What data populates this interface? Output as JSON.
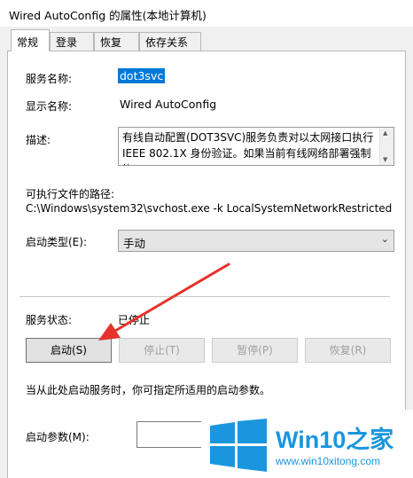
{
  "window": {
    "title": "Wired AutoConfig 的属性(本地计算机)"
  },
  "tabs": [
    {
      "label": "常规",
      "active": true
    },
    {
      "label": "登录",
      "active": false
    },
    {
      "label": "恢复",
      "active": false
    },
    {
      "label": "依存关系",
      "active": false
    }
  ],
  "general": {
    "service_name_label": "服务名称:",
    "service_name_value": "dot3svc",
    "display_name_label": "显示名称:",
    "display_name_value": "Wired AutoConfig",
    "description_label": "描述:",
    "description_value": "有线自动配置(DOT3SVC)服务负责对以太网接口执行 IEEE 802.1X 身份验证。如果当前有线网络部署强制执",
    "exe_path_label": "可执行文件的路径:",
    "exe_path_value": "C:\\Windows\\system32\\svchost.exe -k LocalSystemNetworkRestricted",
    "startup_type_label": "启动类型(E):",
    "startup_type_value": "手动",
    "service_status_label": "服务状态:",
    "service_status_value": "已停止",
    "buttons": {
      "start": "启动(S)",
      "stop": "停止(T)",
      "pause": "暂停(P)",
      "resume": "恢复(R)"
    },
    "hint": "当从此处启动服务时，你可指定所适用的启动参数。",
    "start_params_label": "启动参数(M):"
  },
  "watermark": {
    "brand": "Win10之家",
    "url": "www.win10xitong.com"
  },
  "colors": {
    "selection": "#0078d7",
    "arrow": "#e5322d",
    "logo_blue": "#1a96de"
  }
}
